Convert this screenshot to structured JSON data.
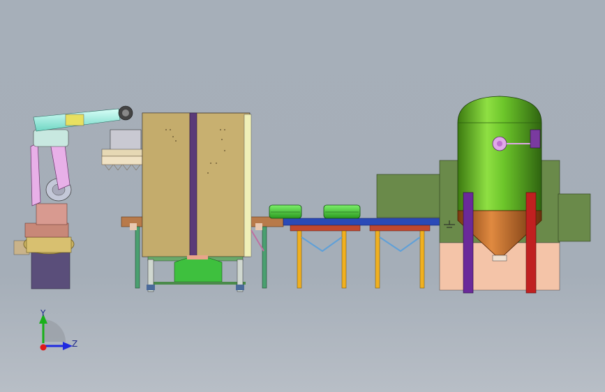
{
  "scene": {
    "background_top": "#a6afb9",
    "background_bottom": "#b8bec6"
  },
  "triad": {
    "y_label": "Y",
    "z_label": "Z",
    "y_color": "#19b019",
    "z_color": "#1f2ae0",
    "origin_color": "#e01919"
  },
  "components": {
    "robot": "industrial-robot-arm",
    "cabinet": "processing-cabinet",
    "conveyor": "roller-conveyor",
    "workpieces": "green-workpiece",
    "tank": "pressure-vessel"
  }
}
